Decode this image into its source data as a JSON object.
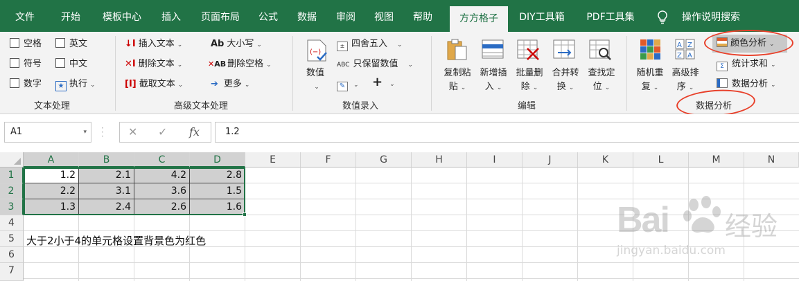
{
  "menu": {
    "tabs": [
      "文件",
      "开始",
      "模板中心",
      "插入",
      "页面布局",
      "公式",
      "数据",
      "审阅",
      "视图",
      "帮助",
      "方方格子",
      "DIY工具箱",
      "PDF工具集"
    ],
    "active_tab": "方方格子",
    "search_hint": "操作说明搜索"
  },
  "ribbon": {
    "text_group": {
      "label": "文本处理",
      "checks": [
        "空格",
        "英文",
        "符号",
        "中文",
        "数字"
      ],
      "exec": "执行"
    },
    "adv_group": {
      "label": "高级文本处理",
      "insert": "插入文本",
      "delete": "删除文本",
      "extract": "截取文本",
      "case": "大小写",
      "del_space": "删除空格",
      "more": "更多"
    },
    "num_group": {
      "label": "数值录入",
      "value": "数值",
      "round": "四舍五入",
      "keep_num": "只保留数值"
    },
    "edit_group": {
      "label": "编辑",
      "copy_paste": [
        "复制粘",
        "贴"
      ],
      "add_insert": [
        "新增插",
        "入"
      ],
      "batch_delete": [
        "批量删",
        "除"
      ],
      "merge_convert": [
        "合并转",
        "换"
      ],
      "find_locate": [
        "查找定",
        "位"
      ]
    },
    "analysis_group": {
      "label": "数据分析",
      "random": [
        "随机重",
        "复"
      ],
      "sort": [
        "高级排",
        "序"
      ],
      "color_analysis": "颜色分析",
      "stat_sum": "统计求和",
      "data_analysis": "数据分析"
    }
  },
  "formula_bar": {
    "name_box": "A1",
    "fx": "fx",
    "value": "1.2"
  },
  "grid": {
    "columns": [
      "A",
      "B",
      "C",
      "D",
      "E",
      "F",
      "G",
      "H",
      "I",
      "J",
      "K",
      "L",
      "M",
      "N"
    ],
    "rows": [
      "1",
      "2",
      "3",
      "4",
      "5",
      "6",
      "7"
    ],
    "data": [
      [
        "1.2",
        "2.1",
        "4.2",
        "2.8"
      ],
      [
        "2.2",
        "3.1",
        "3.6",
        "1.5"
      ],
      [
        "1.3",
        "2.4",
        "2.6",
        "1.6"
      ]
    ],
    "note": "大于2小于4的单元格设置背景色为红色"
  },
  "watermark": {
    "brand": "Bai",
    "brand2": "经验",
    "url": "jingyan.baidu.com"
  },
  "colors": {
    "excel_green": "#217346",
    "highlight": "#e8402a",
    "cell_fill": "#d0d0d0"
  }
}
